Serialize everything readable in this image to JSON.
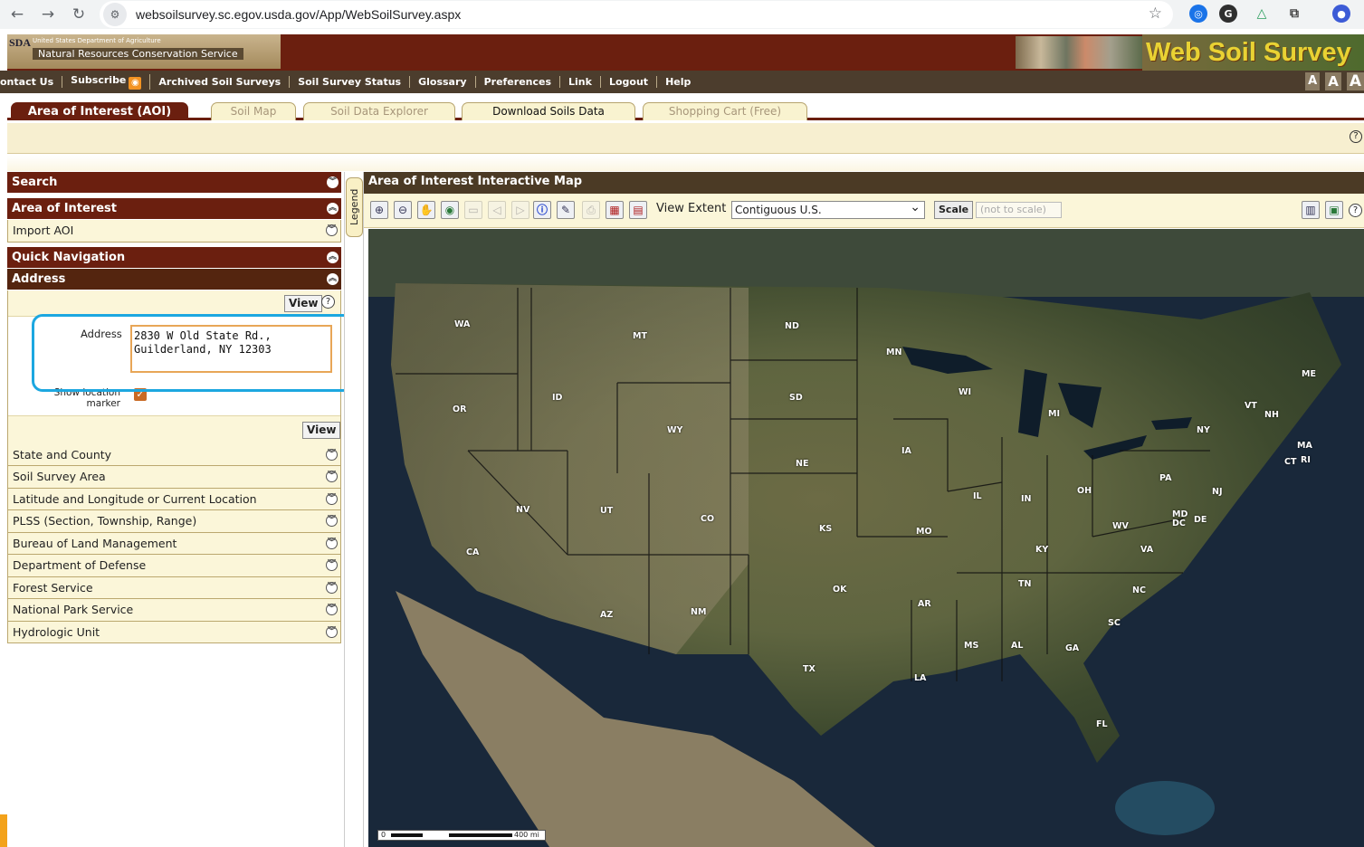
{
  "browser": {
    "url": "websoilsurvey.sc.egov.usda.gov/App/WebSoilSurvey.aspx"
  },
  "header": {
    "usda_short": "SDA",
    "usda_dept": "United States Department of Agriculture",
    "agency": "Natural Resources Conservation Service",
    "logo_text": "Web Soil Survey"
  },
  "topnav": {
    "links": [
      "ontact Us",
      "Subscribe",
      "Archived Soil Surveys",
      "Soil Survey Status",
      "Glossary",
      "Preferences",
      "Link",
      "Logout",
      "Help"
    ],
    "font_sizes": [
      "A",
      "A",
      "A"
    ]
  },
  "tabs": [
    "Area of Interest (AOI)",
    "Soil Map",
    "Soil Data Explorer",
    "Download Soils Data",
    "Shopping Cart (Free)"
  ],
  "left": {
    "search": "Search",
    "aoi": "Area of Interest",
    "import_aoi": "Import AOI",
    "quick_nav": "Quick Navigation",
    "address": "Address",
    "view": "View",
    "address_label": "Address",
    "address_value": "2830 W Old State Rd.,\nGuilderland, NY 12303",
    "show_location": "Show location marker",
    "nav_items": [
      "State and County",
      "Soil Survey Area",
      "Latitude and Longitude or Current Location",
      "PLSS (Section, Township, Range)",
      "Bureau of Land Management",
      "Department of Defense",
      "Forest Service",
      "National Park Service",
      "Hydrologic Unit"
    ]
  },
  "map": {
    "title": "Area of Interest Interactive Map",
    "legend": "Legend",
    "view_extent_label": "View Extent",
    "view_extent_value": "Contiguous U.S.",
    "scale_btn": "Scale",
    "scale_value": "(not to scale)",
    "scalebar_start": "0",
    "scalebar_end": "400 mi",
    "states": [
      "WA",
      "MT",
      "ND",
      "MN",
      "ME",
      "OR",
      "ID",
      "SD",
      "WI",
      "VT",
      "NH",
      "WY",
      "MI",
      "NY",
      "MA",
      "CT",
      "RI",
      "IA",
      "NE",
      "PA",
      "NJ",
      "IL",
      "IN",
      "OH",
      "NV",
      "UT",
      "CO",
      "MD",
      "DC",
      "DE",
      "WV",
      "CA",
      "KS",
      "MO",
      "KY",
      "VA",
      "TN",
      "NC",
      "OK",
      "AR",
      "AZ",
      "NM",
      "SC",
      "MS",
      "AL",
      "GA",
      "TX",
      "LA",
      "FL"
    ]
  },
  "colors": {
    "brand_maroon": "#6b1f0f",
    "panel_cream": "#fbf6d9",
    "highlight_blue": "#1ca7e0"
  }
}
